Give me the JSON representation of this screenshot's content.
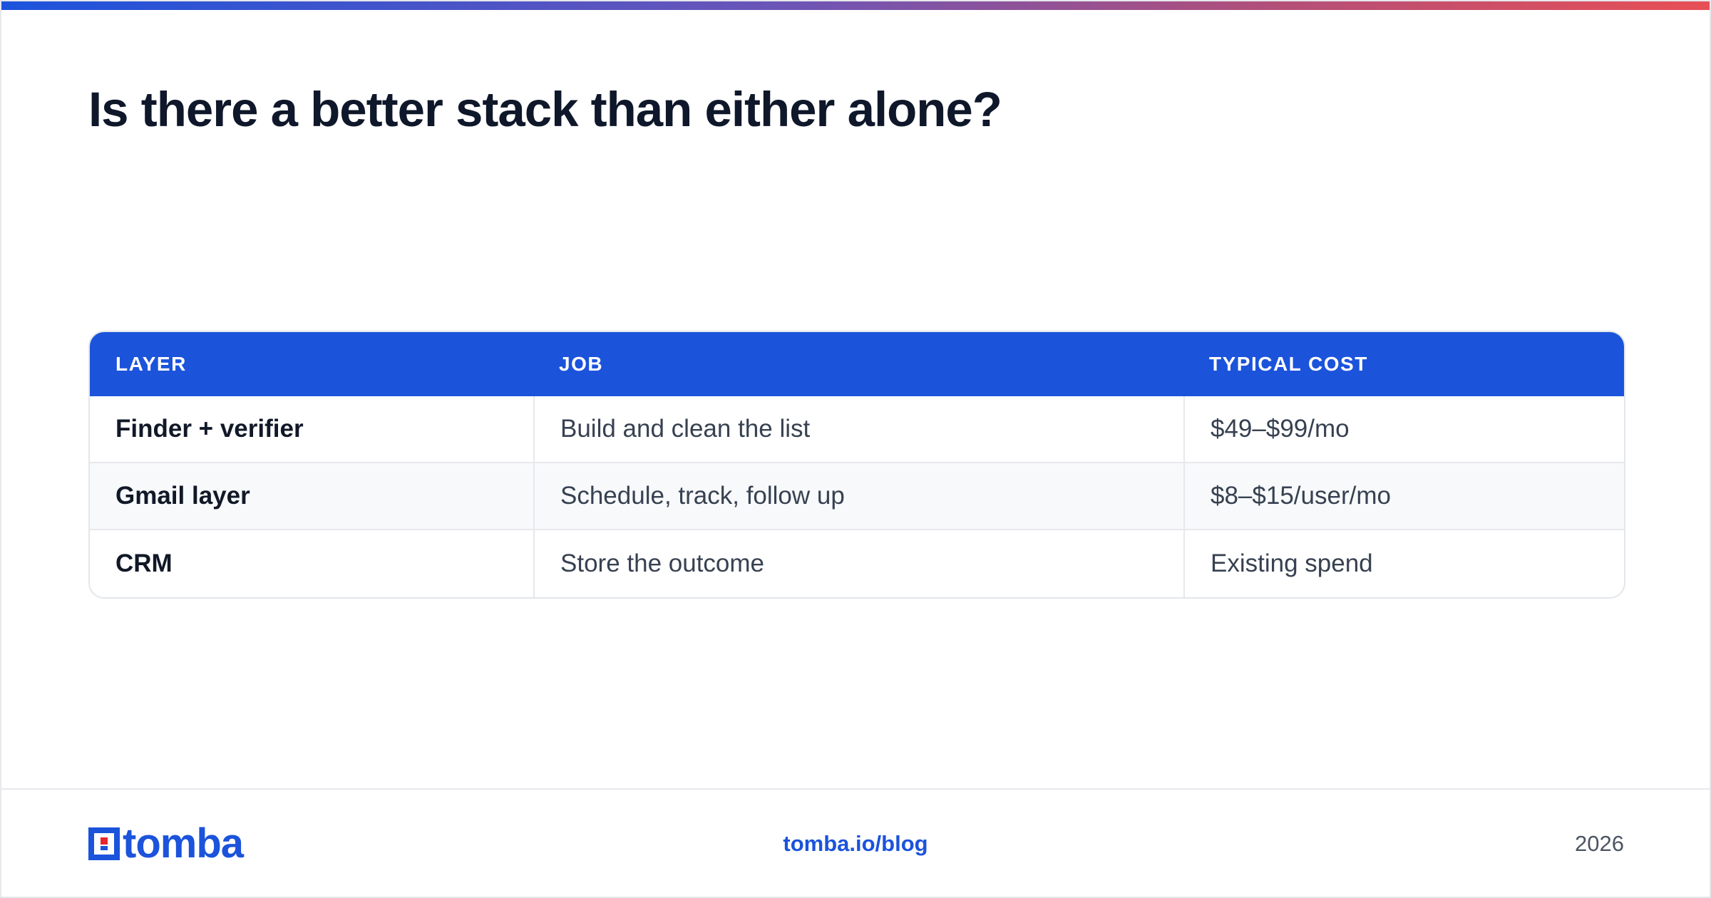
{
  "title": "Is there a better stack than either alone?",
  "table": {
    "headers": [
      "LAYER",
      "JOB",
      "TYPICAL COST"
    ],
    "rows": [
      [
        "Finder + verifier",
        "Build and clean the list",
        "$49–$99/mo"
      ],
      [
        "Gmail layer",
        "Schedule, track, follow up",
        "$8–$15/user/mo"
      ],
      [
        "CRM",
        "Store the outcome",
        "Existing spend"
      ]
    ]
  },
  "footer": {
    "logo_text": "tomba",
    "link": "tomba.io/blog",
    "year": "2026"
  },
  "colors": {
    "brand_blue": "#1b53db",
    "logo_accent_red": "#e8262d",
    "gradient_start": "#1c53dc",
    "gradient_end": "#e84f55"
  }
}
